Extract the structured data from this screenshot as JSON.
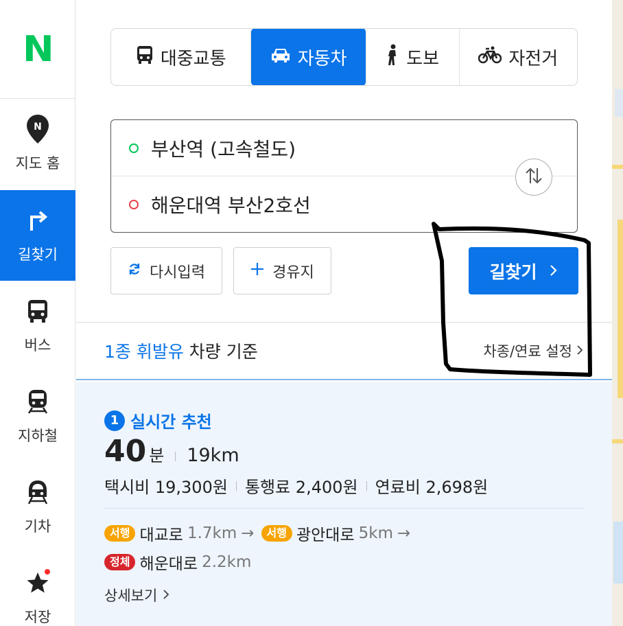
{
  "sidebar": {
    "logo": "N",
    "items": [
      {
        "label": "지도 홈",
        "icon": "map-pin-icon"
      },
      {
        "label": "길찾기",
        "icon": "turn-right-icon",
        "active": true
      },
      {
        "label": "버스",
        "icon": "bus-icon"
      },
      {
        "label": "지하철",
        "icon": "subway-icon"
      },
      {
        "label": "기차",
        "icon": "train-icon"
      },
      {
        "label": "저장",
        "icon": "star-icon",
        "has_notification_dot": true
      }
    ]
  },
  "modes": [
    {
      "label": "대중교통",
      "icon": "bus-icon"
    },
    {
      "label": "자동차",
      "icon": "car-icon",
      "selected": true
    },
    {
      "label": "도보",
      "icon": "walk-icon"
    },
    {
      "label": "자전거",
      "icon": "bike-icon"
    }
  ],
  "route": {
    "start": "부산역 (고속철도)",
    "end": "해운대역 부산2호선"
  },
  "actions": {
    "reset": "다시입력",
    "waypoint": "경유지",
    "search": "길찾기"
  },
  "vehicle": {
    "title_highlight": "1종 휘발유",
    "title_rest": " 차량 기준",
    "setting": "차종/연료 설정"
  },
  "result": {
    "rank": "1",
    "title": "실시간 추천",
    "time_value": "40",
    "time_unit": "분",
    "distance": "19km",
    "costs": [
      "택시비 19,300원",
      "통행료 2,400원",
      "연료비 2,698원"
    ],
    "roads_line1": [
      {
        "badge": "서행",
        "name": "대교로",
        "dist": "1.7km"
      },
      {
        "badge": "서행",
        "name": "광안대로",
        "dist": "5km"
      }
    ],
    "roads_line2": [
      {
        "badge": "정체",
        "name": "해운대로",
        "dist": "2.2km"
      }
    ],
    "detail": "상세보기"
  },
  "colors": {
    "accent": "#0a74e8",
    "brand_green": "#03c75a",
    "slow_badge": "#f7a400",
    "jam_badge": "#d6262c",
    "result_bg": "#eef5fd"
  }
}
